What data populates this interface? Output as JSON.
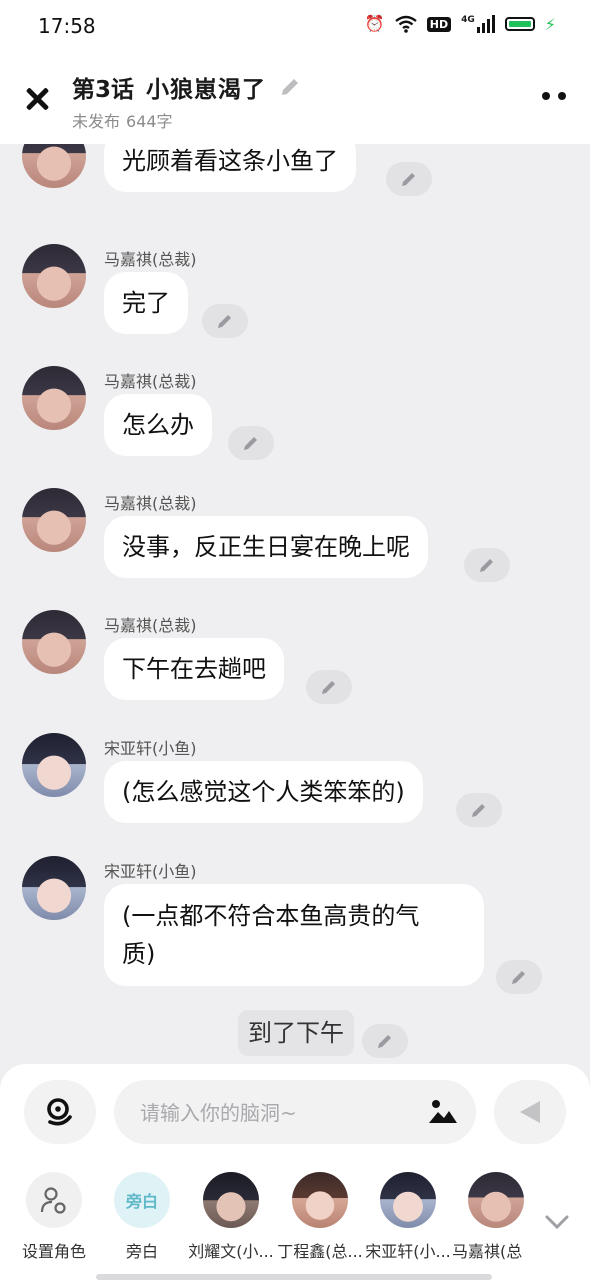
{
  "status_bar": {
    "time": "17:58",
    "network": "4G",
    "hd": "HD"
  },
  "header": {
    "episode": "第3话",
    "title": "小狼崽渴了",
    "status": "未发布",
    "word_count": "644字"
  },
  "messages": [
    {
      "sender": "",
      "text": "光顾着看这条小鱼了"
    },
    {
      "sender": "马嘉祺(总裁)",
      "text": "完了"
    },
    {
      "sender": "马嘉祺(总裁)",
      "text": "怎么办"
    },
    {
      "sender": "马嘉祺(总裁)",
      "text": "没事，反正生日宴在晚上呢"
    },
    {
      "sender": "马嘉祺(总裁)",
      "text": "下午在去趟吧"
    },
    {
      "sender": "宋亚轩(小鱼)",
      "text": "(怎么感觉这个人类笨笨的)"
    },
    {
      "sender": "宋亚轩(小鱼)",
      "text_line1": "(一点都不符合本鱼高贵的气",
      "text_line2": "质)"
    }
  ],
  "narration": {
    "text": "到了下午"
  },
  "composer": {
    "placeholder": "请输入你的脑洞~"
  },
  "roles": [
    {
      "label": "设置角色"
    },
    {
      "label": "旁白",
      "badge": "旁白"
    },
    {
      "label": "刘耀文(小..."
    },
    {
      "label": "丁程鑫(总..."
    },
    {
      "label": "宋亚轩(小..."
    },
    {
      "label": "马嘉祺(总"
    }
  ],
  "colors": {
    "accent_green": "#22c05a",
    "narration_teal": "#5fb9c9",
    "background": "#efeff1"
  }
}
